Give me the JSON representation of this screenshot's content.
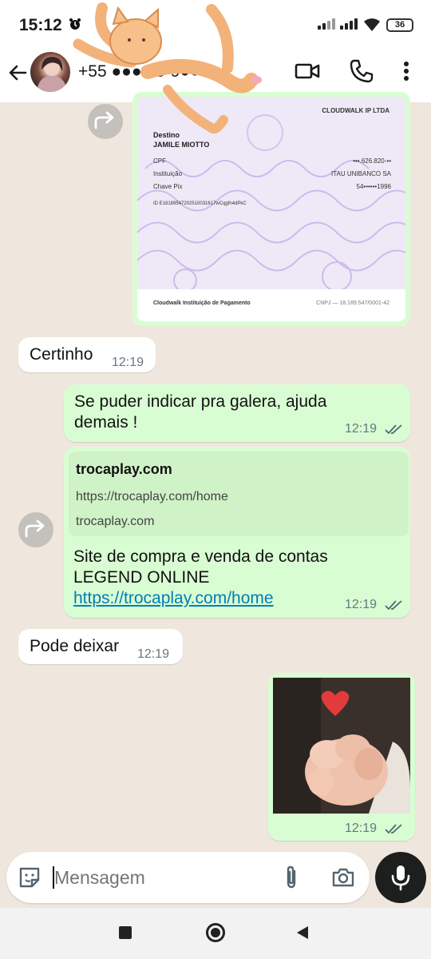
{
  "status_bar": {
    "time": "15:12",
    "battery": "36"
  },
  "header": {
    "contact_name": "+55 ●●● 15-9●●●"
  },
  "messages": {
    "receipt": {
      "issuer": "CLOUDWALK IP LTDA",
      "destino_label": "Destino",
      "destino_name": "JAMILE MIOTTO",
      "rows": [
        {
          "label": "CPF",
          "value": "•••.626.820-••"
        },
        {
          "label": "Instituição",
          "value": "ITAU UNIBANCO SA"
        },
        {
          "label": "Chave Pix",
          "value": "54••••••1996"
        }
      ],
      "id_line": "ID E18189547202510031617wCqgfn4dPkC",
      "footer_left": "Cloudwalk Instituição de Pagamento",
      "footer_right": "CNPJ — 18.189.547/0001-42"
    },
    "m1": {
      "text": "Certinho",
      "time": "12:19"
    },
    "m2": {
      "text_line1": "Se puder indicar pra galera, ajuda",
      "text_line2": "demais !",
      "time": "12:19"
    },
    "m3": {
      "preview_title": "trocaplay.com",
      "preview_url": "https://trocaplay.com/home",
      "preview_domain": "trocaplay.com",
      "text_line1": "Site de compra e venda de contas",
      "text_line2": "LEGEND ONLINE",
      "link": "https://trocaplay.com/home",
      "time": "12:19"
    },
    "m4": {
      "text": "Pode deixar",
      "time": "12:19"
    },
    "m5": {
      "time": "12:19"
    }
  },
  "composer": {
    "placeholder": "Mensagem"
  },
  "colors": {
    "outgoing": "#d9fdd3",
    "incoming": "#ffffff",
    "link": "#027eb5",
    "read_ticks": "#53656f"
  },
  "icons": [
    "alarm-icon",
    "back-arrow-icon",
    "video-call-icon",
    "phone-icon",
    "more-options-icon",
    "forward-icon",
    "double-check-icon",
    "emoji-sticker-icon",
    "attach-icon",
    "camera-icon",
    "mic-icon",
    "recents-icon",
    "home-icon",
    "back-icon"
  ]
}
